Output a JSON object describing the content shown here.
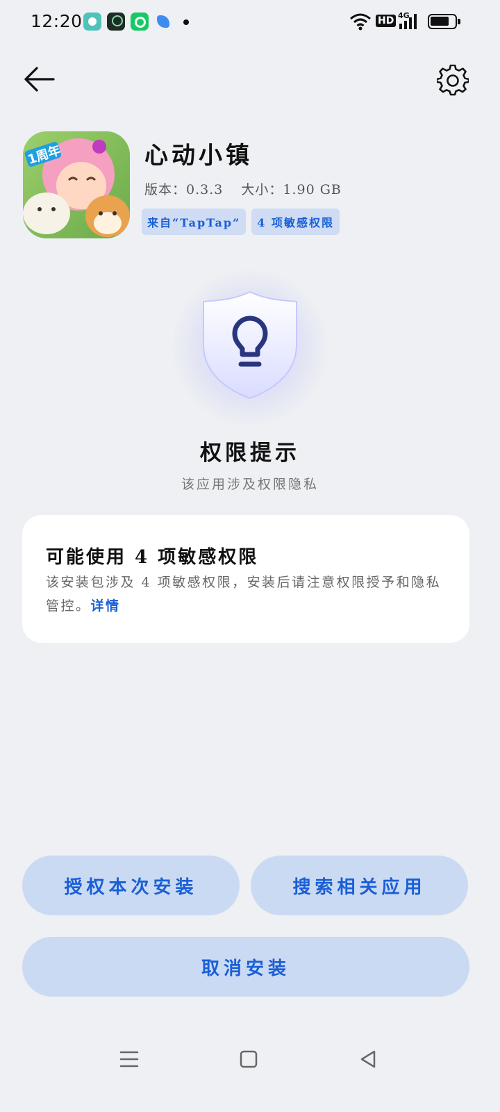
{
  "status_bar": {
    "time": "12:20",
    "network": "4G",
    "hd_label": "HD",
    "notification_icons": [
      "chat-bubble-icon",
      "security-app-icon",
      "green-ring-app-icon",
      "blue-leaf-app-icon"
    ]
  },
  "header": {
    "back_icon": "arrow-left-icon",
    "settings_icon": "gear-icon"
  },
  "app": {
    "name": "心动小镇",
    "version": "版本：0.3.3",
    "size": "大小：1.90 GB",
    "icon_badge": "1周年",
    "tags": [
      "来自“TapTap”",
      "4 项敏感权限"
    ]
  },
  "hero": {
    "icon": "shield-lightbulb-icon",
    "title": "权限提示",
    "subtitle": "该应用涉及权限隐私"
  },
  "card": {
    "title": "可能使用 4 项敏感权限",
    "body": "该安装包涉及 4 项敏感权限，安装后请注意权限授予和隐私管控。",
    "link": "详情"
  },
  "buttons": {
    "authorize": "授权本次安装",
    "search": "搜索相关应用",
    "cancel": "取消安装"
  },
  "colors": {
    "background": "#eef0f3",
    "accent": "#1a5fd6",
    "button_bg": "#cbdaf3",
    "tag_bg": "#cfdcf4"
  }
}
